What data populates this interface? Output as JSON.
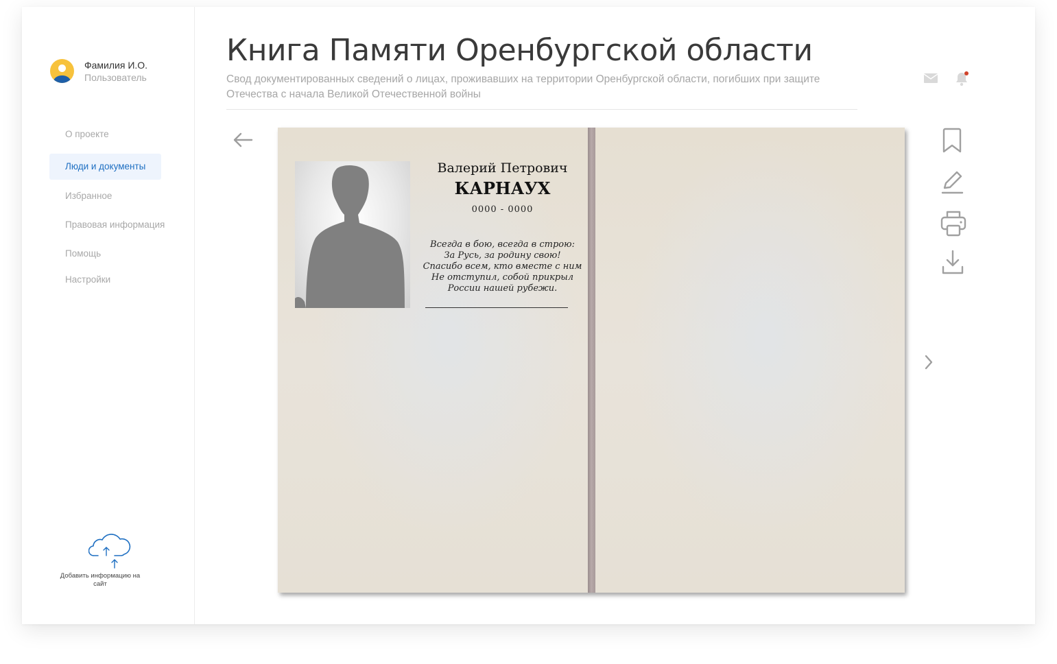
{
  "user": {
    "name": "Фамилия И.О.",
    "role": "Пользователь"
  },
  "nav": {
    "items": [
      {
        "label": "О проекте",
        "active": false
      },
      {
        "label": "Люди и документы",
        "active": true
      },
      {
        "label": "Избранное",
        "active": false
      },
      {
        "label": "Правовая информация",
        "active": false
      },
      {
        "label": "Помощь",
        "active": false
      },
      {
        "label": "Настройки",
        "active": false
      }
    ]
  },
  "upload": {
    "label": "Добавить информацию на сайт",
    "icon": "cloud-upload-icon"
  },
  "header": {
    "title": "Книга Памяти Оренбургской области",
    "subtitle": "Свод документированных сведений о лицах, проживавших на территории Оренбургской области, погибших при защите Отечества с начала Великой Отечественной войны",
    "icons": [
      "mail-icon",
      "bell-icon"
    ],
    "notification_dot": true
  },
  "book": {
    "person": {
      "first_names": "Валерий Петрович",
      "last_name": "КАРНАУХ",
      "dates": "0000 - 0000"
    },
    "poem": [
      "Всегда в бою, всегда в строю:",
      "За Русь, за родину свою!",
      "Спасибо всем, кто вместе с ним",
      "Не отступил, собой прикрыл",
      "России нашей рубежи."
    ]
  },
  "tools": [
    "bookmark-icon",
    "edit-icon",
    "print-icon",
    "download-icon"
  ],
  "navigation": [
    "back-arrow-icon",
    "next-chevron-icon"
  ],
  "colors": {
    "accent": "#1e6fc2",
    "active_bg": "#eef4fd",
    "muted_text": "#a8a8a8",
    "title_text": "#3a3a3a",
    "paper": "#e8e2d7",
    "spine": "#a89a9a",
    "avatar_yellow": "#f7c23c",
    "notification": "#d0432b"
  }
}
